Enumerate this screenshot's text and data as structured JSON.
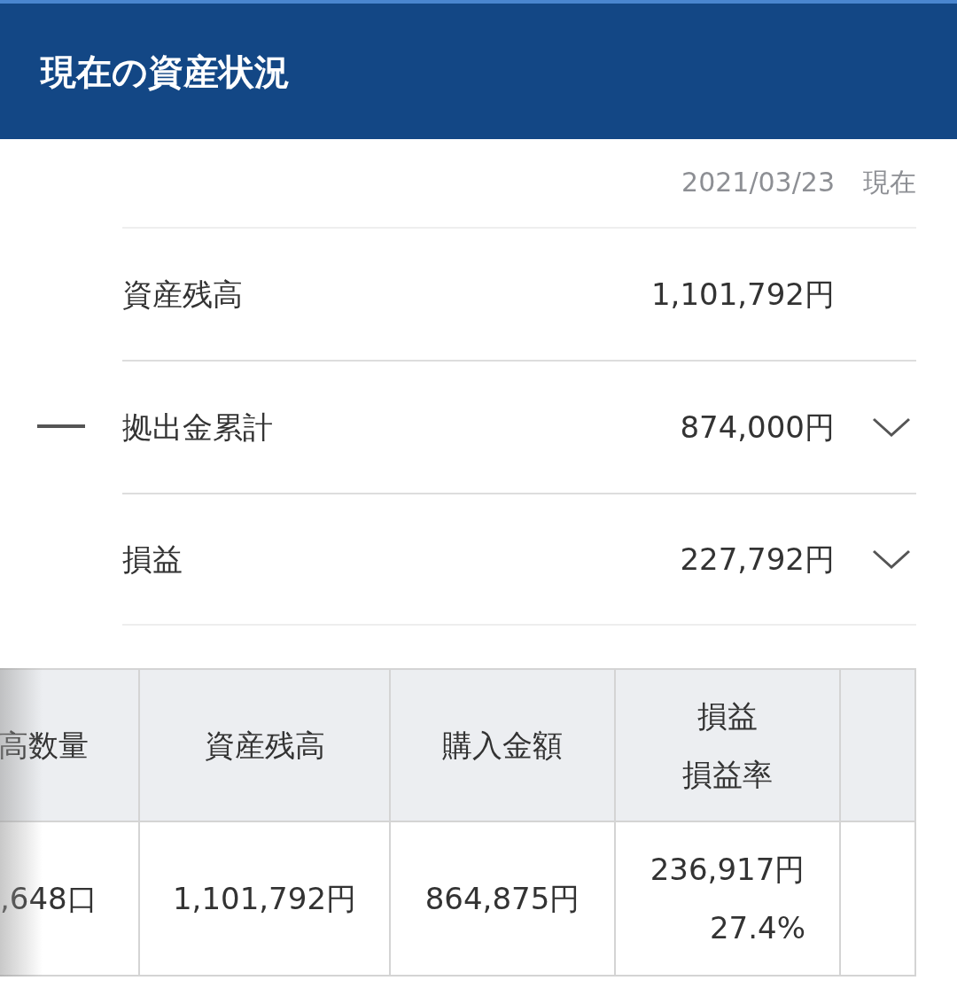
{
  "header": {
    "title": "現在の資産状況"
  },
  "as_of": {
    "date": "2021/03/23",
    "suffix": "現在"
  },
  "summary": [
    {
      "label": "資産残高",
      "value": "1,101,792円",
      "kind": "plain"
    },
    {
      "label": "拠出金累計",
      "value": "874,000円",
      "kind": "subtract",
      "expanded": false
    },
    {
      "label": "損益",
      "value": "227,792円",
      "kind": "expandable",
      "expanded": false
    }
  ],
  "table": {
    "columns": [
      {
        "lines": [
          "高数量"
        ]
      },
      {
        "lines": [
          "資産残高"
        ]
      },
      {
        "lines": [
          "購入金額"
        ]
      },
      {
        "lines": [
          "損益",
          "損益率"
        ]
      }
    ],
    "rows": [
      {
        "cells": [
          {
            "lines": [
              ",648口"
            ]
          },
          {
            "lines": [
              "1,101,792円"
            ]
          },
          {
            "lines": [
              "864,875円"
            ]
          },
          {
            "lines": [
              "236,917円",
              "27.4%"
            ]
          }
        ]
      }
    ]
  }
}
